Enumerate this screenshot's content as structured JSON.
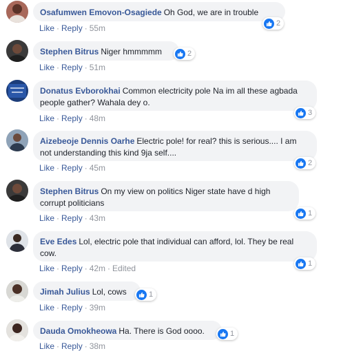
{
  "actions": {
    "like": "Like",
    "reply": "Reply",
    "separator": "·",
    "edited": "Edited"
  },
  "colors": {
    "author": "#385898",
    "bubble": "#f2f3f5",
    "like_badge": "#1877f2"
  },
  "icons": {
    "reaction": "like-thumb-icon",
    "avatar": "profile-photo"
  },
  "comments": [
    {
      "author": "Osafumwen Emovon-Osagiede",
      "text": "Oh God, we are in trouble",
      "time": "55m",
      "likes": "2"
    },
    {
      "author": "Stephen Bitrus",
      "text": "Niger hmmmmm",
      "time": "51m",
      "likes": "2"
    },
    {
      "author": "Donatus Evborokhai",
      "text": "Common electricity pole Na im all these agbada people gather? Wahala dey o.",
      "time": "48m",
      "likes": "3"
    },
    {
      "author": "Aizebeoje Dennis Oarhe",
      "text": "Electric pole! for real? this is serious.... I am not understanding this kind 9ja self....",
      "time": "45m",
      "likes": "2"
    },
    {
      "author": "Stephen Bitrus",
      "text": "On my view on politics Niger state have d high corrupt politicians",
      "time": "43m",
      "likes": "1"
    },
    {
      "author": "Eve Edes",
      "text": "Lol, electric pole that individual can afford, lol. They be real cow.",
      "time": "42m",
      "likes": "1"
    },
    {
      "author": "Jimah Julius",
      "text": "Lol, cows",
      "time": "39m",
      "likes": "1"
    },
    {
      "author": "Dauda Omokheowa",
      "text": "Ha. There is God oooo.",
      "time": "38m",
      "likes": "1"
    }
  ]
}
